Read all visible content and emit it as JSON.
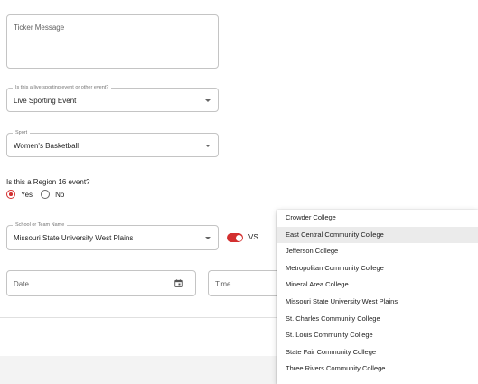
{
  "ticker": {
    "placeholder": "Ticker Message"
  },
  "event_type": {
    "label": "Is this a live sporting event or other event?",
    "value": "Live Sporting Event"
  },
  "sport": {
    "label": "Sport",
    "value": "Women's Basketball"
  },
  "region": {
    "question": "Is this a Region 16 event?",
    "options": [
      "Yes",
      "No"
    ],
    "selected": "Yes"
  },
  "school": {
    "label": "School or Team Name",
    "value": "Missouri State University West Plains"
  },
  "vs_toggle": {
    "label": "VS",
    "on": true
  },
  "date": {
    "placeholder": "Date"
  },
  "time": {
    "placeholder": "Time"
  },
  "dropdown": {
    "highlighted": "East Central Community College",
    "options": [
      "Crowder College",
      "East Central Community College",
      "Jefferson College",
      "Metropolitan Community College",
      "Mineral Area College",
      "Missouri State University West Plains",
      "St. Charles Community College",
      "St. Louis Community College",
      "State Fair Community College",
      "Three Rivers Community College"
    ]
  },
  "colors": {
    "accent": "#d32f2f",
    "border": "#c4c4c4",
    "footer_bg": "#f3f3f3",
    "highlight_bg": "#ebebeb"
  },
  "icons": {
    "select_caret": "caret-down-icon",
    "date_picker": "calendar-icon",
    "radio": "radio-icon"
  }
}
